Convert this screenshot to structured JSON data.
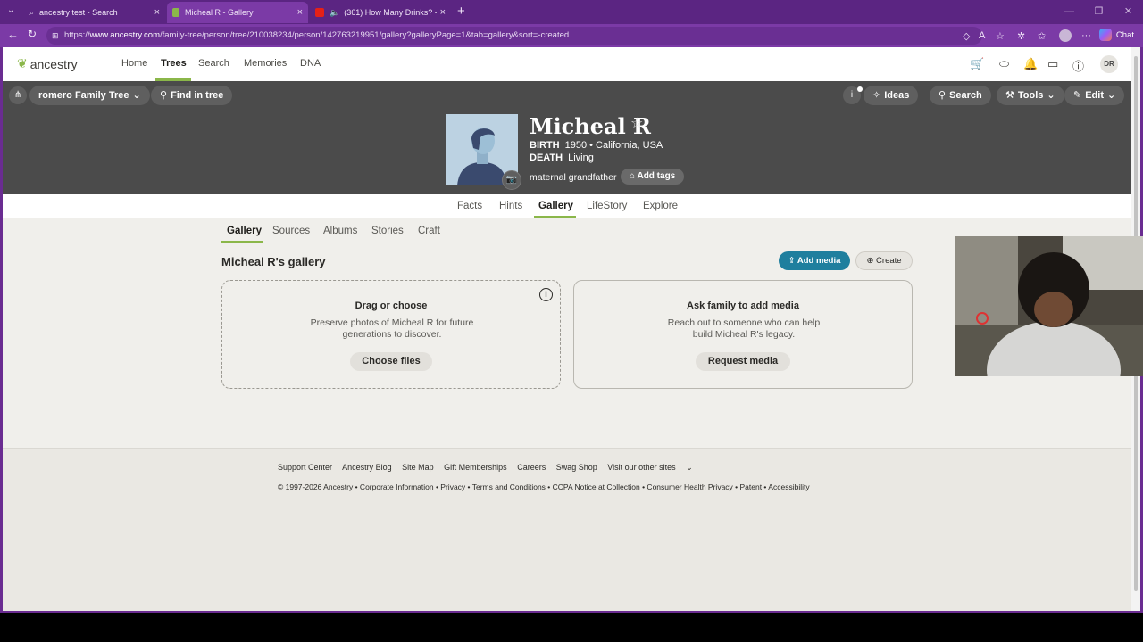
{
  "browser": {
    "tabs": [
      {
        "label": "ancestry test - Search",
        "favicon": "search-icon"
      },
      {
        "label": "Micheal R - Gallery",
        "favicon": "ancestry-leaf-icon"
      },
      {
        "label": "(361) How Many Drinks? - Yo",
        "favicon": "youtube-icon"
      }
    ],
    "url_prefix": "https://",
    "url_host": "www.ancestry.com",
    "url_path": "/family-tree/person/tree/210038234/person/142763219951/gallery?galleryPage=1&tab=gallery&sort=-created",
    "chat_label": "Chat"
  },
  "topnav": {
    "logo_text": "ancestry",
    "links": [
      "Home",
      "Trees",
      "Search",
      "Memories",
      "DNA"
    ],
    "active_link": "Trees",
    "user_initials": "DR"
  },
  "person_bar": {
    "tree_name": "romero Family Tree",
    "find_in_tree": "Find in tree",
    "ideas": "Ideas",
    "search": "Search",
    "tools": "Tools",
    "edit": "Edit"
  },
  "person": {
    "name": "Micheal R",
    "birth_label": "BIRTH",
    "birth_value": "1950 • California, USA",
    "death_label": "DEATH",
    "death_value": "Living",
    "relation": "maternal grandfather",
    "add_tags": "Add tags"
  },
  "person_tabs": [
    "Facts",
    "Hints",
    "Gallery",
    "LifeStory",
    "Explore"
  ],
  "sub_tabs": [
    "Gallery",
    "Sources",
    "Albums",
    "Stories",
    "Craft"
  ],
  "gallery": {
    "title": "Micheal R's gallery",
    "add_media": "Add media",
    "create": "Create",
    "drop_card": {
      "title": "Drag or choose",
      "text": "Preserve photos of Micheal R for future generations to discover.",
      "button": "Choose files"
    },
    "ask_card": {
      "title": "Ask family to add media",
      "text": "Reach out to someone who can help build Micheal R's legacy.",
      "button": "Request media"
    }
  },
  "footer": {
    "links": [
      "Support Center",
      "Ancestry Blog",
      "Site Map",
      "Gift Memberships",
      "Careers",
      "Swag Shop",
      "Visit our other sites"
    ],
    "legal": "© 1997-2026 Ancestry • Corporate Information • Privacy • Terms and Conditions • CCPA Notice at Collection • Consumer Health Privacy • Patent • Accessibility"
  },
  "colors": {
    "browser_frame": "#6a2c91",
    "header_bg": "#4b4b4b",
    "accent_green": "#8bb74a",
    "add_media_blue": "#1f7f9e"
  }
}
